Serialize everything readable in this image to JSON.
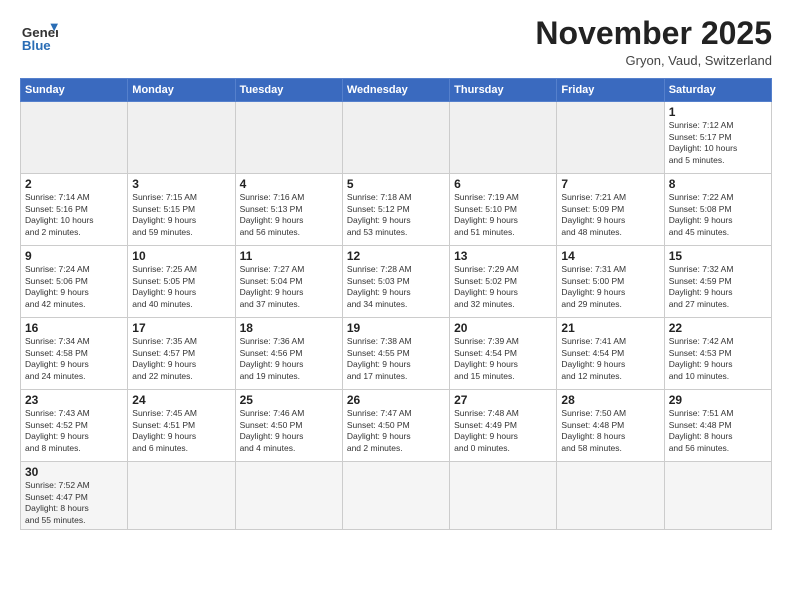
{
  "header": {
    "logo_general": "General",
    "logo_blue": "Blue",
    "month_title": "November 2025",
    "subtitle": "Gryon, Vaud, Switzerland"
  },
  "days_of_week": [
    "Sunday",
    "Monday",
    "Tuesday",
    "Wednesday",
    "Thursday",
    "Friday",
    "Saturday"
  ],
  "weeks": [
    [
      {
        "day": "",
        "info": "",
        "empty": true
      },
      {
        "day": "",
        "info": "",
        "empty": true
      },
      {
        "day": "",
        "info": "",
        "empty": true
      },
      {
        "day": "",
        "info": "",
        "empty": true
      },
      {
        "day": "",
        "info": "",
        "empty": true
      },
      {
        "day": "",
        "info": "",
        "empty": true
      },
      {
        "day": "1",
        "info": "Sunrise: 7:12 AM\nSunset: 5:17 PM\nDaylight: 10 hours\nand 5 minutes."
      }
    ],
    [
      {
        "day": "2",
        "info": "Sunrise: 7:14 AM\nSunset: 5:16 PM\nDaylight: 10 hours\nand 2 minutes."
      },
      {
        "day": "3",
        "info": "Sunrise: 7:15 AM\nSunset: 5:15 PM\nDaylight: 9 hours\nand 59 minutes."
      },
      {
        "day": "4",
        "info": "Sunrise: 7:16 AM\nSunset: 5:13 PM\nDaylight: 9 hours\nand 56 minutes."
      },
      {
        "day": "5",
        "info": "Sunrise: 7:18 AM\nSunset: 5:12 PM\nDaylight: 9 hours\nand 53 minutes."
      },
      {
        "day": "6",
        "info": "Sunrise: 7:19 AM\nSunset: 5:10 PM\nDaylight: 9 hours\nand 51 minutes."
      },
      {
        "day": "7",
        "info": "Sunrise: 7:21 AM\nSunset: 5:09 PM\nDaylight: 9 hours\nand 48 minutes."
      },
      {
        "day": "8",
        "info": "Sunrise: 7:22 AM\nSunset: 5:08 PM\nDaylight: 9 hours\nand 45 minutes."
      }
    ],
    [
      {
        "day": "9",
        "info": "Sunrise: 7:24 AM\nSunset: 5:06 PM\nDaylight: 9 hours\nand 42 minutes."
      },
      {
        "day": "10",
        "info": "Sunrise: 7:25 AM\nSunset: 5:05 PM\nDaylight: 9 hours\nand 40 minutes."
      },
      {
        "day": "11",
        "info": "Sunrise: 7:27 AM\nSunset: 5:04 PM\nDaylight: 9 hours\nand 37 minutes."
      },
      {
        "day": "12",
        "info": "Sunrise: 7:28 AM\nSunset: 5:03 PM\nDaylight: 9 hours\nand 34 minutes."
      },
      {
        "day": "13",
        "info": "Sunrise: 7:29 AM\nSunset: 5:02 PM\nDaylight: 9 hours\nand 32 minutes."
      },
      {
        "day": "14",
        "info": "Sunrise: 7:31 AM\nSunset: 5:00 PM\nDaylight: 9 hours\nand 29 minutes."
      },
      {
        "day": "15",
        "info": "Sunrise: 7:32 AM\nSunset: 4:59 PM\nDaylight: 9 hours\nand 27 minutes."
      }
    ],
    [
      {
        "day": "16",
        "info": "Sunrise: 7:34 AM\nSunset: 4:58 PM\nDaylight: 9 hours\nand 24 minutes."
      },
      {
        "day": "17",
        "info": "Sunrise: 7:35 AM\nSunset: 4:57 PM\nDaylight: 9 hours\nand 22 minutes."
      },
      {
        "day": "18",
        "info": "Sunrise: 7:36 AM\nSunset: 4:56 PM\nDaylight: 9 hours\nand 19 minutes."
      },
      {
        "day": "19",
        "info": "Sunrise: 7:38 AM\nSunset: 4:55 PM\nDaylight: 9 hours\nand 17 minutes."
      },
      {
        "day": "20",
        "info": "Sunrise: 7:39 AM\nSunset: 4:54 PM\nDaylight: 9 hours\nand 15 minutes."
      },
      {
        "day": "21",
        "info": "Sunrise: 7:41 AM\nSunset: 4:54 PM\nDaylight: 9 hours\nand 12 minutes."
      },
      {
        "day": "22",
        "info": "Sunrise: 7:42 AM\nSunset: 4:53 PM\nDaylight: 9 hours\nand 10 minutes."
      }
    ],
    [
      {
        "day": "23",
        "info": "Sunrise: 7:43 AM\nSunset: 4:52 PM\nDaylight: 9 hours\nand 8 minutes."
      },
      {
        "day": "24",
        "info": "Sunrise: 7:45 AM\nSunset: 4:51 PM\nDaylight: 9 hours\nand 6 minutes."
      },
      {
        "day": "25",
        "info": "Sunrise: 7:46 AM\nSunset: 4:50 PM\nDaylight: 9 hours\nand 4 minutes."
      },
      {
        "day": "26",
        "info": "Sunrise: 7:47 AM\nSunset: 4:50 PM\nDaylight: 9 hours\nand 2 minutes."
      },
      {
        "day": "27",
        "info": "Sunrise: 7:48 AM\nSunset: 4:49 PM\nDaylight: 9 hours\nand 0 minutes."
      },
      {
        "day": "28",
        "info": "Sunrise: 7:50 AM\nSunset: 4:48 PM\nDaylight: 8 hours\nand 58 minutes."
      },
      {
        "day": "29",
        "info": "Sunrise: 7:51 AM\nSunset: 4:48 PM\nDaylight: 8 hours\nand 56 minutes."
      }
    ],
    [
      {
        "day": "30",
        "info": "Sunrise: 7:52 AM\nSunset: 4:47 PM\nDaylight: 8 hours\nand 55 minutes.",
        "last": true
      },
      {
        "day": "",
        "info": "",
        "empty": true,
        "last": true
      },
      {
        "day": "",
        "info": "",
        "empty": true,
        "last": true
      },
      {
        "day": "",
        "info": "",
        "empty": true,
        "last": true
      },
      {
        "day": "",
        "info": "",
        "empty": true,
        "last": true
      },
      {
        "day": "",
        "info": "",
        "empty": true,
        "last": true
      },
      {
        "day": "",
        "info": "",
        "empty": true,
        "last": true
      }
    ]
  ]
}
